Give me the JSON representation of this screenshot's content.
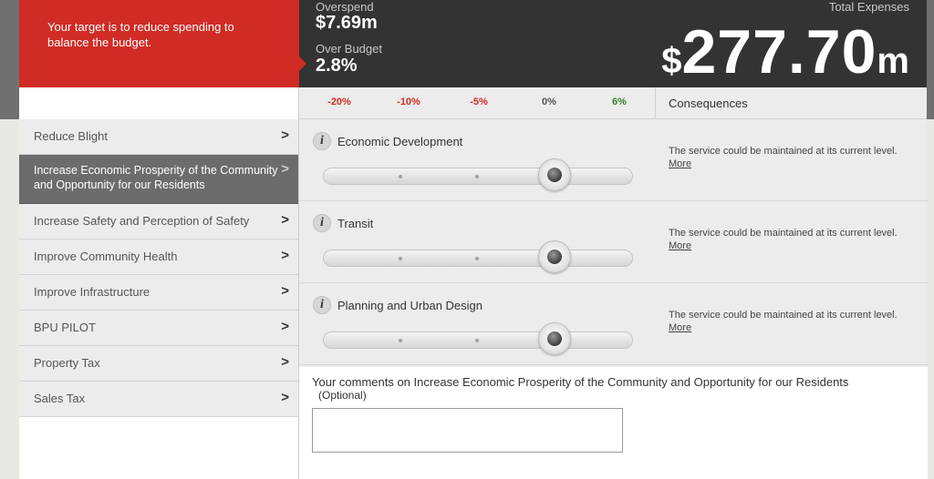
{
  "header": {
    "target_message": "Your target is to reduce spending to balance the budget.",
    "overspend_label": "Overspend",
    "overspend_value": "$7.69m",
    "over_budget_label": "Over Budget",
    "over_budget_value": "2.8%",
    "total_label": "Total Expenses",
    "total_symbol": "$",
    "total_number": "277.70",
    "total_unit": "m"
  },
  "scale": {
    "ticks": [
      "-20%",
      "-10%",
      "-5%",
      "0%",
      "6%"
    ],
    "consequences_label": "Consequences"
  },
  "sidebar": {
    "items": [
      {
        "label": "Reduce Blight",
        "chevron": ">"
      },
      {
        "label": "Increase Economic Prosperity of the Community and Opportunity for our Residents",
        "chevron": ">",
        "active": true
      },
      {
        "label": "Increase Safety and Perception of Safety",
        "chevron": ">"
      },
      {
        "label": "Improve Community Health",
        "chevron": ">"
      },
      {
        "label": "Improve Infrastructure",
        "chevron": ">"
      },
      {
        "label": "BPU PILOT",
        "chevron": ">"
      },
      {
        "label": "Property Tax",
        "chevron": ">"
      },
      {
        "label": "Sales Tax",
        "chevron": ">"
      }
    ]
  },
  "services": [
    {
      "info": "i",
      "name": "Economic Development",
      "consequence": "The service could be maintained at its current level.",
      "more": "More",
      "slider_change_pct": 0
    },
    {
      "info": "i",
      "name": "Transit",
      "consequence": "The service could be maintained at its current level.",
      "more": "More",
      "slider_change_pct": 0
    },
    {
      "info": "i",
      "name": "Planning and Urban Design",
      "consequence": "The service could be maintained at its current level.",
      "more": "More",
      "slider_change_pct": 0
    }
  ],
  "comments": {
    "label": "Your comments on Increase Economic Prosperity of the Community and Opportunity for our Residents",
    "optional": "(Optional)",
    "value": ""
  },
  "colors": {
    "accent_red": "#d02b25",
    "header_dark": "#333333",
    "positive_green": "#3c7a2a"
  }
}
